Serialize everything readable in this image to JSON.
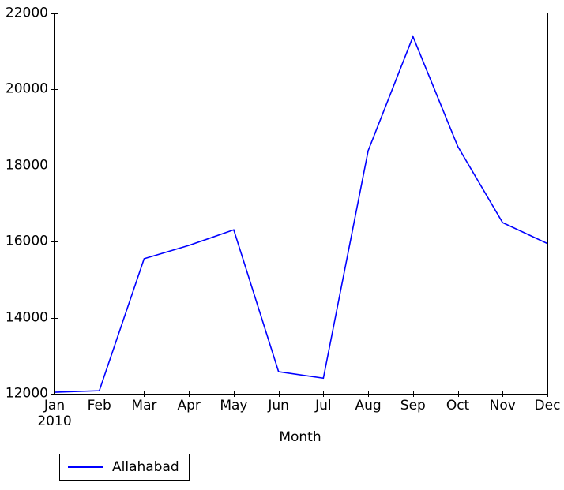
{
  "chart_data": {
    "type": "line",
    "title": "",
    "subtitle": "",
    "xlabel": "Month",
    "ylabel": "",
    "categories": [
      "Jan",
      "Feb",
      "Mar",
      "Apr",
      "May",
      "Jun",
      "Jul",
      "Aug",
      "Sep",
      "Oct",
      "Nov",
      "Dec"
    ],
    "x_sublabels": [
      "2010",
      "",
      "",
      "",
      "",
      "",
      "",
      "",
      "",
      "",
      "",
      ""
    ],
    "series": [
      {
        "name": "Allahabad",
        "color": "#0000FF",
        "values": [
          12040,
          12080,
          15550,
          15900,
          16310,
          12580,
          12410,
          18390,
          21390,
          18500,
          16500,
          15950
        ]
      }
    ],
    "ylim": [
      12000,
      22000
    ],
    "yticks": [
      12000,
      14000,
      16000,
      18000,
      20000,
      22000
    ],
    "ytick_labels": [
      "12000",
      "14000",
      "16000",
      "18000",
      "20000",
      "22000"
    ],
    "grid": false,
    "legend_position": "below-left",
    "legend_entries": [
      {
        "label": "Allahabad",
        "color": "#0000FF"
      }
    ]
  },
  "axes": {
    "spine_color": "#000000",
    "background": "#ffffff"
  }
}
